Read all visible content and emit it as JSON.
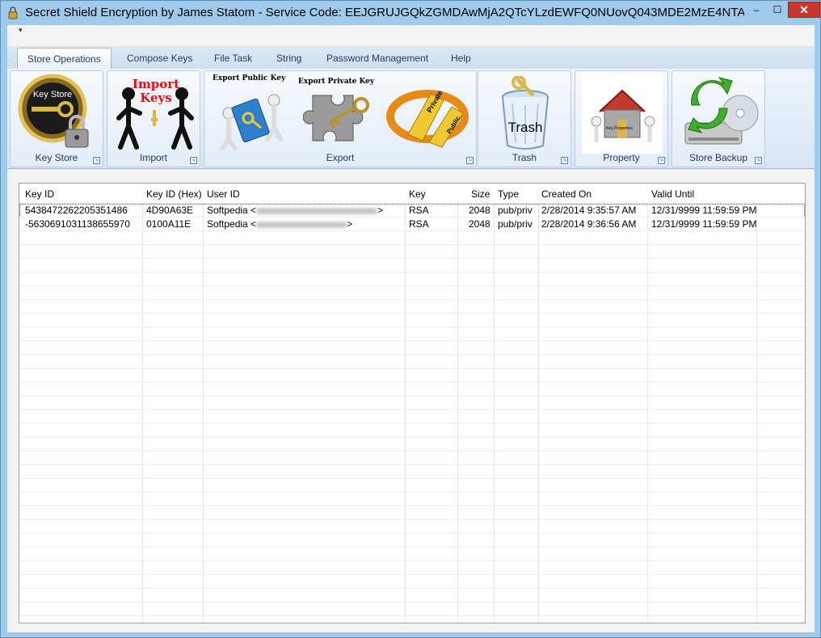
{
  "window": {
    "title": "Secret Shield Encryption by James Statom - Service Code: EEJGRUJGQkZGMDAwMjA2QTcYLzdEWFQ0NUovQ043MDE2MzE4NTAzME..."
  },
  "titlebar_buttons": {
    "minimize": "–",
    "maximize": "☐",
    "close": "✕"
  },
  "quick_access": {
    "dropdown": "▾"
  },
  "tabs": [
    {
      "label": "Store Operations"
    },
    {
      "label": "Compose Keys"
    },
    {
      "label": "File Task"
    },
    {
      "label": "String"
    },
    {
      "label": "Password Management"
    },
    {
      "label": "Help"
    }
  ],
  "ribbon": {
    "groups": [
      {
        "label": "Key Store",
        "buttons": [
          {
            "icon": "key-store-lock-icon",
            "text": "Key Store"
          }
        ]
      },
      {
        "label": "Import",
        "buttons": [
          {
            "icon": "import-keys-icon",
            "text": "Import Keys"
          }
        ]
      },
      {
        "label": "Export",
        "buttons": [
          {
            "icon": "export-public-key-icon",
            "text": "Export Public Key"
          },
          {
            "icon": "export-private-key-icon",
            "text": "Export Private Key"
          },
          {
            "icon": "private-public-keys-icon",
            "text1": "Private",
            "text2": "Public"
          }
        ]
      },
      {
        "label": "Trash",
        "buttons": [
          {
            "icon": "trash-bin-icon",
            "text": "Trash"
          }
        ]
      },
      {
        "label": "Property",
        "buttons": [
          {
            "icon": "key-properties-icon",
            "text": "Key Properties"
          }
        ]
      },
      {
        "label": "Store Backup",
        "buttons": [
          {
            "icon": "backup-drive-icon",
            "text": ""
          }
        ]
      }
    ]
  },
  "table": {
    "columns": [
      "Key ID",
      "Key ID (Hex)",
      "User ID",
      "Key",
      "Size",
      "Type",
      "Created On",
      "Valid Until"
    ],
    "rows": [
      [
        "5438472262205351486",
        "4D90A63E",
        "Softpedia <",
        "RSA",
        "2048",
        "pub/priv",
        "2/28/2014 9:35:57 AM",
        "12/31/9999 11:59:59 PM"
      ],
      [
        "-5630691031138655970",
        "0100A11E",
        "Softpedia <",
        "RSA",
        "2048",
        "pub/priv",
        "2/28/2014 9:36:56 AM",
        "12/31/9999 11:59:59 PM"
      ]
    ],
    "user_id_suffix": ">"
  },
  "colors": {
    "title_bg": "#9fcaea",
    "close_btn": "#c7382c",
    "ribbon_text": "#1e395b"
  }
}
